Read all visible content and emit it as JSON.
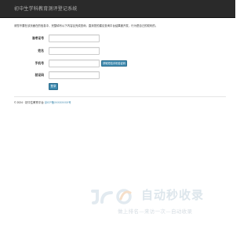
{
  "navbar": {
    "brand": "初中生学科教育测评登记系统"
  },
  "notice": "请您不要在该页面在的信息中，完整填写以下内容且完成查询，直到您的建议查询平台结果被开发，行为是自己的权利的。",
  "form": {
    "fields": [
      {
        "label": "准考证号",
        "value": "",
        "placeholder": ""
      },
      {
        "label": "姓名",
        "value": "",
        "placeholder": ""
      },
      {
        "label": "手机号",
        "value": "",
        "placeholder": ""
      },
      {
        "label": "验证码",
        "value": "",
        "placeholder": ""
      }
    ],
    "sms_button": "获取短信手机验证码",
    "submit": "登录"
  },
  "footer": {
    "text": "© 2024 · 初中生教育平台",
    "link": "京ICP备XXXXXXXX号"
  },
  "watermark": {
    "title": "自动秒收录",
    "tagline": "做上排名—来访一次—自动收录",
    "colors": {
      "primary": "#dfe8ee",
      "accent": "#f6dfc9"
    }
  },
  "colors": {
    "navbar": "#2a2a2a",
    "brand_text": "#b0b0b0",
    "button": "#3a87ad",
    "link": "#3a87ad"
  }
}
